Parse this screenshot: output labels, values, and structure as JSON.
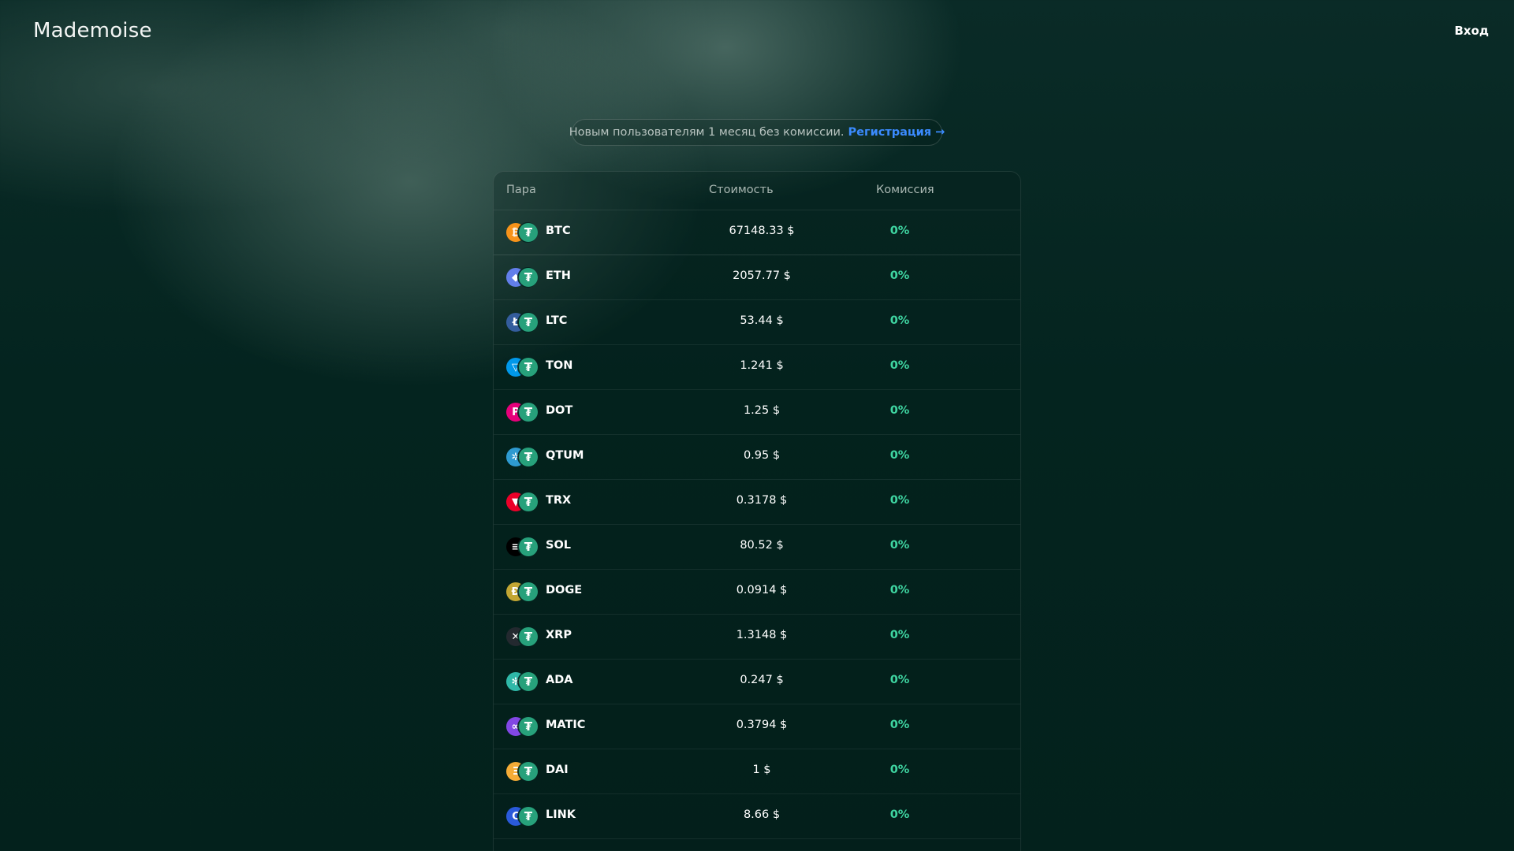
{
  "header": {
    "logo": "Mademoise",
    "login_label": "Вход"
  },
  "promo": {
    "text": "Новым пользователям 1 месяц без комиссии.",
    "link_label": "Регистрация →"
  },
  "table": {
    "columns": [
      "Пара",
      "Стоимость",
      "Комиссия"
    ],
    "rows": [
      {
        "symbol": "BTC",
        "price": "67148.33 $",
        "fee": "0%",
        "icon": "bitcoin-icon",
        "color": "#f7931a",
        "glyph": "₿"
      },
      {
        "symbol": "ETH",
        "price": "2057.77 $",
        "fee": "0%",
        "icon": "ethereum-icon",
        "color": "#627eea",
        "glyph": "◆"
      },
      {
        "symbol": "LTC",
        "price": "53.44 $",
        "fee": "0%",
        "icon": "litecoin-icon",
        "color": "#345d9d",
        "glyph": "Ł"
      },
      {
        "symbol": "TON",
        "price": "1.241 $",
        "fee": "0%",
        "icon": "toncoin-icon",
        "color": "#0098ea",
        "glyph": "▽"
      },
      {
        "symbol": "DOT",
        "price": "1.25 $",
        "fee": "0%",
        "icon": "polkadot-icon",
        "color": "#e6007a",
        "glyph": "P"
      },
      {
        "symbol": "QTUM",
        "price": "0.95 $",
        "fee": "0%",
        "icon": "qtum-icon",
        "color": "#2e9ad0",
        "glyph": "✲"
      },
      {
        "symbol": "TRX",
        "price": "0.3178 $",
        "fee": "0%",
        "icon": "tron-icon",
        "color": "#eb0029",
        "glyph": "▼"
      },
      {
        "symbol": "SOL",
        "price": "80.52 $",
        "fee": "0%",
        "icon": "solana-icon",
        "color": "#000000",
        "glyph": "≡"
      },
      {
        "symbol": "DOGE",
        "price": "0.0914 $",
        "fee": "0%",
        "icon": "dogecoin-icon",
        "color": "#c2a633",
        "glyph": "Ð"
      },
      {
        "symbol": "XRP",
        "price": "1.3148 $",
        "fee": "0%",
        "icon": "xrp-icon",
        "color": "#23292f",
        "glyph": "✕"
      },
      {
        "symbol": "ADA",
        "price": "0.247 $",
        "fee": "0%",
        "icon": "cardano-icon",
        "color": "#2fb8a8",
        "glyph": "✻"
      },
      {
        "symbol": "MATIC",
        "price": "0.3794 $",
        "fee": "0%",
        "icon": "polygon-icon",
        "color": "#8247e5",
        "glyph": "∞"
      },
      {
        "symbol": "DAI",
        "price": "1 $",
        "fee": "0%",
        "icon": "dai-icon",
        "color": "#f5ac37",
        "glyph": "Ξ"
      },
      {
        "symbol": "LINK",
        "price": "8.66 $",
        "fee": "0%",
        "icon": "chainlink-icon",
        "color": "#2a5ada",
        "glyph": "C"
      }
    ]
  },
  "quote_icon": {
    "icon": "tether-icon",
    "color": "#27a17b",
    "glyph": "₮"
  },
  "colors": {
    "background": "#04241f",
    "accent_link": "#3b8bff",
    "fee_green": "#3fd6a2"
  }
}
